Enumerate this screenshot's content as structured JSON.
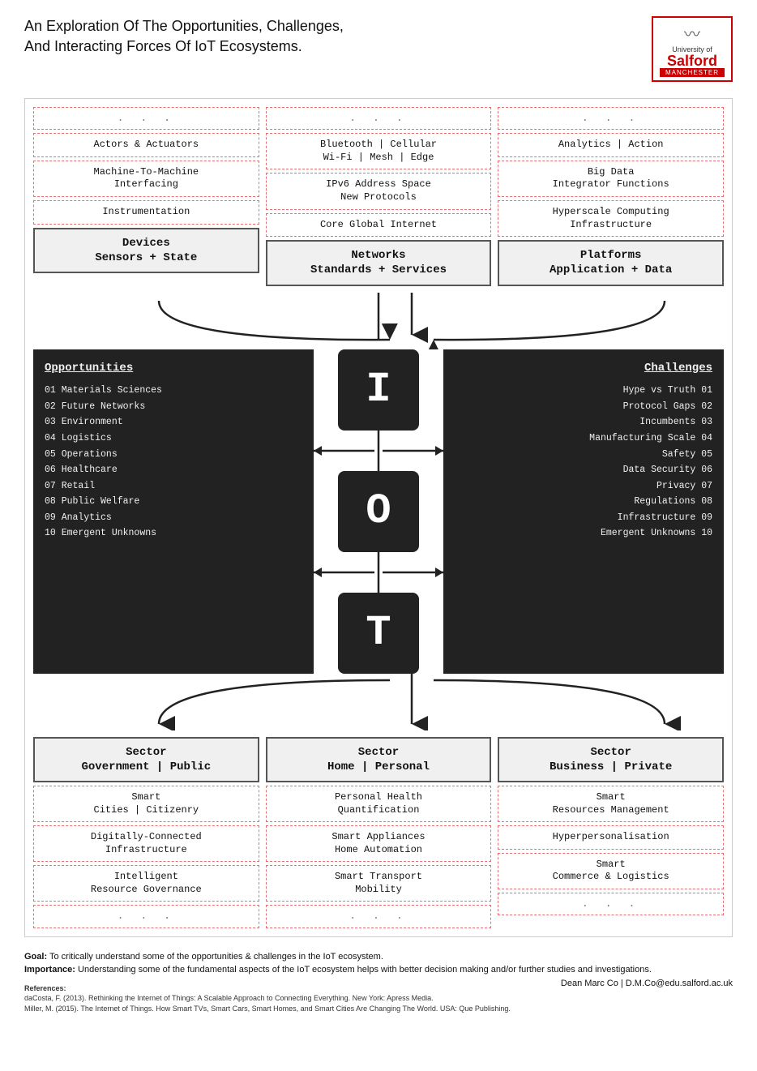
{
  "header": {
    "title_line1": "An Exploration Of The Opportunities, Challenges,",
    "title_line2": "And Interacting Forces Of IoT Ecosystems.",
    "logo_university": "University of",
    "logo_salford": "Salford",
    "logo_manchester": "MANCHESTER"
  },
  "top": {
    "col1": {
      "dots": ". . .",
      "row1": "Actors & Actuators",
      "row2": "Machine-To-Machine\nInterfacing",
      "row3": "Instrumentation",
      "bold": "Devices\nSensors + State"
    },
    "col2": {
      "dots": ". . .",
      "row1": "Bluetooth | Cellular\nWi-Fi | Mesh | Edge",
      "row2": "IPv6 Address Space\nNew Protocols",
      "row3": "Core Global Internet",
      "bold": "Networks\nStandards + Services"
    },
    "col3": {
      "dots": ". . .",
      "row1": "Analytics | Action",
      "row2": "Big Data\nIntegrator Functions",
      "row3": "Hyperscale Computing\nInfrastructure",
      "bold": "Platforms\nApplication + Data"
    }
  },
  "iot": {
    "I": "I",
    "O": "O",
    "T": "T"
  },
  "opportunities": {
    "title": "Opportunities",
    "items": [
      "01 Materials Sciences",
      "02 Future Networks",
      "03 Environment",
      "04 Logistics",
      "05 Operations",
      "06 Healthcare",
      "07 Retail",
      "08 Public Welfare",
      "09 Analytics",
      "10 Emergent Unknowns"
    ]
  },
  "challenges": {
    "title": "Challenges",
    "items": [
      "Hype vs Truth 01",
      "Protocol Gaps 02",
      "Incumbents 03",
      "Manufacturing Scale 04",
      "Safety 05",
      "Data Security 06",
      "Privacy 07",
      "Regulations 08",
      "Infrastructure 09",
      "Emergent Unknowns 10"
    ]
  },
  "bottom": {
    "col1": {
      "bold": "Sector\nGovernment | Public",
      "row1": "Smart\nCities | Citizenry",
      "row2": "Digitally-Connected\nInfrastructure",
      "row3": "Intelligent\nResource Governance",
      "dots": ". . ."
    },
    "col2": {
      "bold": "Sector\nHome | Personal",
      "row1": "Personal Health\nQuantification",
      "row2": "Smart Appliances\nHome Automation",
      "row3": "Smart Transport\nMobility",
      "dots": ". . ."
    },
    "col3": {
      "bold": "Sector\nBusiness | Private",
      "row1": "Smart\nResources Management",
      "row2": "Hyperpersonalisation",
      "row3": "Smart\nCommerce & Logistics",
      "dots": ". . ."
    }
  },
  "footer": {
    "goal_label": "Goal:",
    "goal_text": " To critically understand some of the opportunities & challenges in the IoT ecosystem.",
    "importance_label": "Importance:",
    "importance_text": " Understanding some of the fundamental aspects of the IoT ecosystem helps with better decision making and/or further studies and investigations.",
    "email": "Dean Marc Co | D.M.Co@edu.salford.ac.uk",
    "refs_title": "References:",
    "ref1": "daCosta, F. (2013). Rethinking the Internet of Things: A Scalable Approach to Connecting Everything. New York: Apress Media.",
    "ref2": "Miller, M. (2015). The Internet of Things. How Smart TVs, Smart Cars, Smart Homes, and Smart Cities Are Changing The World. USA: Que Publishing."
  }
}
